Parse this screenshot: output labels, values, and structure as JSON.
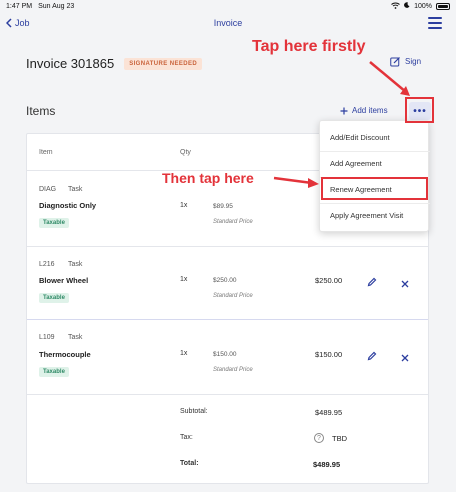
{
  "status_bar": {
    "time": "1:47 PM",
    "date": "Sun Aug 23",
    "battery": "100%"
  },
  "nav": {
    "back_label": "Job",
    "title": "Invoice"
  },
  "invoice": {
    "title": "Invoice 301865",
    "badge": "SIGNATURE NEEDED",
    "sign_label": "Sign"
  },
  "items_section": {
    "label": "Items",
    "add_label": "Add items",
    "more_label": "•••"
  },
  "columns": {
    "item": "Item",
    "qty": "Qty"
  },
  "rows": [
    {
      "code": "DIAG",
      "type": "Task",
      "name": "Diagnostic Only",
      "taxable": "Taxable",
      "qty": "1x",
      "price": "$89.95",
      "price_label": "Standard Price",
      "total": ""
    },
    {
      "code": "L216",
      "type": "Task",
      "name": "Blower Wheel",
      "taxable": "Taxable",
      "qty": "1x",
      "price": "$250.00",
      "price_label": "Standard Price",
      "total": "$250.00"
    },
    {
      "code": "L109",
      "type": "Task",
      "name": "Thermocouple",
      "taxable": "Taxable",
      "qty": "1x",
      "price": "$150.00",
      "price_label": "Standard Price",
      "total": "$150.00"
    }
  ],
  "summary": {
    "subtotal_label": "Subtotal:",
    "subtotal": "$489.95",
    "tax_label": "Tax:",
    "tax": "TBD",
    "total_label": "Total:",
    "total": "$489.95"
  },
  "menu": {
    "items": [
      "Add/Edit Discount",
      "Add Agreement",
      "Renew Agreement",
      "Apply Agreement Visit"
    ]
  },
  "annotations": {
    "first": "Tap here firstly",
    "second": "Then tap here",
    "color": "#e3333a"
  },
  "colors": {
    "accent": "#2c3e9f",
    "badge_bg": "#fbe3d6",
    "badge_text": "#c9623a",
    "taxable_bg": "#dff2e9",
    "taxable_text": "#2f8a66"
  }
}
